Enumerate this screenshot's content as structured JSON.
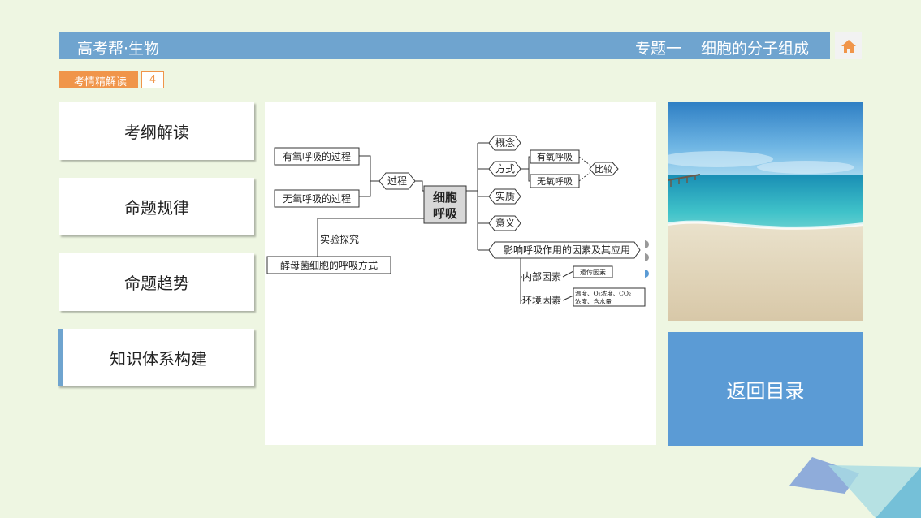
{
  "header": {
    "brand": "高考帮·生物",
    "topic_prefix": "专题一",
    "topic_title": "细胞的分子组成",
    "home_icon": "home-icon"
  },
  "section_tag": {
    "label": "考情精解读",
    "page": "4"
  },
  "nav": {
    "items": [
      {
        "label": "考纲解读"
      },
      {
        "label": "命题规律"
      },
      {
        "label": "命题趋势"
      },
      {
        "label": "知识体系构建"
      }
    ],
    "active_index": 3
  },
  "mindmap": {
    "center": "细胞呼吸",
    "center_line1": "细胞",
    "center_line2": "呼吸",
    "process": "过程",
    "aerobic_process": "有氧呼吸的过程",
    "anaerobic_process": "无氧呼吸的过程",
    "experiment": "实验探究",
    "yeast": "酵母菌细胞的呼吸方式",
    "concept": "概念",
    "mode": "方式",
    "aerobic": "有氧呼吸",
    "anaerobic": "无氧呼吸",
    "compare": "比较",
    "essence": "实质",
    "significance": "意义",
    "factors": "影响呼吸作用的因素及其应用",
    "internal": "内部因素",
    "genetic": "遗传因素",
    "environmental": "环境因素",
    "env_line1": "温度、O₂浓度、CO₂",
    "env_line2": "浓度、含水量"
  },
  "back_button": "返回目录",
  "colors": {
    "background": "#eef6e2",
    "header": "#6fa4cf",
    "tag": "#f0954a",
    "back_button": "#5b9bd5",
    "home_icon": "#f0954a"
  }
}
